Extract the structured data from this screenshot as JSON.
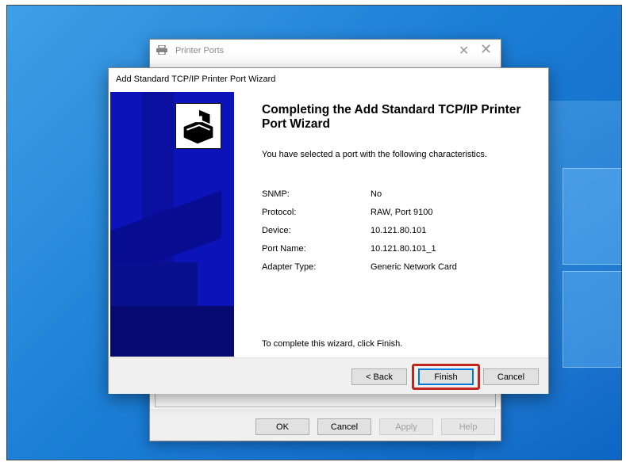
{
  "ports_window": {
    "title": "Printer Ports",
    "buttons": {
      "ok": "OK",
      "cancel": "Cancel",
      "apply": "Apply",
      "help": "Help"
    }
  },
  "wizard": {
    "title": "Add Standard TCP/IP Printer Port Wizard",
    "heading": "Completing the Add Standard TCP/IP Printer Port Wizard",
    "intro": "You have selected a port with the following characteristics.",
    "details": [
      {
        "label": "SNMP:",
        "value": "No"
      },
      {
        "label": "Protocol:",
        "value": "RAW, Port 9100"
      },
      {
        "label": "Device:",
        "value": "10.121.80.101"
      },
      {
        "label": "Port Name:",
        "value": "10.121.80.101_1"
      },
      {
        "label": "Adapter Type:",
        "value": "Generic Network Card"
      }
    ],
    "complete_text": "To complete this wizard, click Finish.",
    "buttons": {
      "back": "< Back",
      "finish": "Finish",
      "cancel": "Cancel"
    }
  },
  "colors": {
    "banner": "#0a14b8",
    "highlight": "#c0261d",
    "desktop": "#1c7fd6"
  }
}
